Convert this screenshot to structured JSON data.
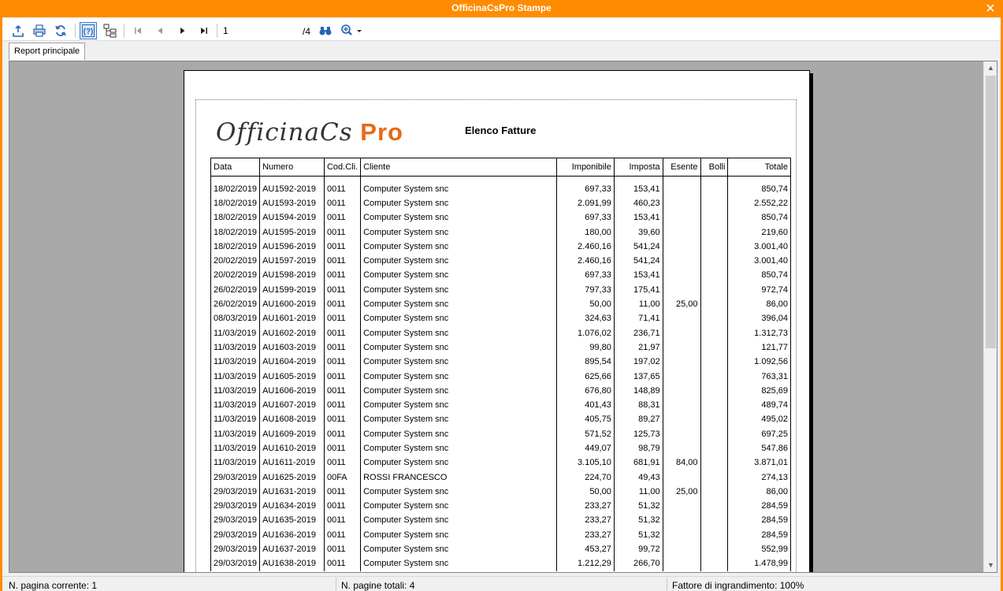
{
  "window": {
    "title": "OfficinaCsPro Stampe"
  },
  "toolbar": {
    "page_current": "1",
    "page_total": "/4",
    "icons": [
      "export-icon",
      "print-icon",
      "refresh-icon",
      "help-icon",
      "tree-icon",
      "first-page-icon",
      "prev-page-icon",
      "next-page-icon",
      "last-page-icon",
      "find-icon",
      "zoom-icon"
    ]
  },
  "tabs": [
    {
      "label": "Report principale"
    }
  ],
  "report": {
    "logo_a": "OfficinaCs",
    "logo_b": "Pro",
    "title": "Elenco Fatture",
    "columns": [
      "Data",
      "Numero",
      "Cod.Cli.",
      "Cliente",
      "Imponibile",
      "Imposta",
      "Esente",
      "Bolli",
      "Totale"
    ],
    "rows": [
      [
        "18/02/2019",
        "AU1592-2019",
        "0011",
        "Computer System snc",
        "697,33",
        "153,41",
        "",
        "",
        "850,74"
      ],
      [
        "18/02/2019",
        "AU1593-2019",
        "0011",
        "Computer System snc",
        "2.091,99",
        "460,23",
        "",
        "",
        "2.552,22"
      ],
      [
        "18/02/2019",
        "AU1594-2019",
        "0011",
        "Computer System snc",
        "697,33",
        "153,41",
        "",
        "",
        "850,74"
      ],
      [
        "18/02/2019",
        "AU1595-2019",
        "0011",
        "Computer System snc",
        "180,00",
        "39,60",
        "",
        "",
        "219,60"
      ],
      [
        "18/02/2019",
        "AU1596-2019",
        "0011",
        "Computer System snc",
        "2.460,16",
        "541,24",
        "",
        "",
        "3.001,40"
      ],
      [
        "20/02/2019",
        "AU1597-2019",
        "0011",
        "Computer System snc",
        "2.460,16",
        "541,24",
        "",
        "",
        "3.001,40"
      ],
      [
        "20/02/2019",
        "AU1598-2019",
        "0011",
        "Computer System snc",
        "697,33",
        "153,41",
        "",
        "",
        "850,74"
      ],
      [
        "26/02/2019",
        "AU1599-2019",
        "0011",
        "Computer System snc",
        "797,33",
        "175,41",
        "",
        "",
        "972,74"
      ],
      [
        "26/02/2019",
        "AU1600-2019",
        "0011",
        "Computer System snc",
        "50,00",
        "11,00",
        "25,00",
        "",
        "86,00"
      ],
      [
        "08/03/2019",
        "AU1601-2019",
        "0011",
        "Computer System snc",
        "324,63",
        "71,41",
        "",
        "",
        "396,04"
      ],
      [
        "11/03/2019",
        "AU1602-2019",
        "0011",
        "Computer System snc",
        "1.076,02",
        "236,71",
        "",
        "",
        "1.312,73"
      ],
      [
        "11/03/2019",
        "AU1603-2019",
        "0011",
        "Computer System snc",
        "99,80",
        "21,97",
        "",
        "",
        "121,77"
      ],
      [
        "11/03/2019",
        "AU1604-2019",
        "0011",
        "Computer System snc",
        "895,54",
        "197,02",
        "",
        "",
        "1.092,56"
      ],
      [
        "11/03/2019",
        "AU1605-2019",
        "0011",
        "Computer System snc",
        "625,66",
        "137,65",
        "",
        "",
        "763,31"
      ],
      [
        "11/03/2019",
        "AU1606-2019",
        "0011",
        "Computer System snc",
        "676,80",
        "148,89",
        "",
        "",
        "825,69"
      ],
      [
        "11/03/2019",
        "AU1607-2019",
        "0011",
        "Computer System snc",
        "401,43",
        "88,31",
        "",
        "",
        "489,74"
      ],
      [
        "11/03/2019",
        "AU1608-2019",
        "0011",
        "Computer System snc",
        "405,75",
        "89,27",
        "",
        "",
        "495,02"
      ],
      [
        "11/03/2019",
        "AU1609-2019",
        "0011",
        "Computer System snc",
        "571,52",
        "125,73",
        "",
        "",
        "697,25"
      ],
      [
        "11/03/2019",
        "AU1610-2019",
        "0011",
        "Computer System snc",
        "449,07",
        "98,79",
        "",
        "",
        "547,86"
      ],
      [
        "11/03/2019",
        "AU1611-2019",
        "0011",
        "Computer System snc",
        "3.105,10",
        "681,91",
        "84,00",
        "",
        "3.871,01"
      ],
      [
        "29/03/2019",
        "AU1625-2019",
        "00FA",
        "ROSSI FRANCESCO",
        "224,70",
        "49,43",
        "",
        "",
        "274,13"
      ],
      [
        "29/03/2019",
        "AU1631-2019",
        "0011",
        "Computer System snc",
        "50,00",
        "11,00",
        "25,00",
        "",
        "86,00"
      ],
      [
        "29/03/2019",
        "AU1634-2019",
        "0011",
        "Computer System snc",
        "233,27",
        "51,32",
        "",
        "",
        "284,59"
      ],
      [
        "29/03/2019",
        "AU1635-2019",
        "0011",
        "Computer System snc",
        "233,27",
        "51,32",
        "",
        "",
        "284,59"
      ],
      [
        "29/03/2019",
        "AU1636-2019",
        "0011",
        "Computer System snc",
        "233,27",
        "51,32",
        "",
        "",
        "284,59"
      ],
      [
        "29/03/2019",
        "AU1637-2019",
        "0011",
        "Computer System snc",
        "453,27",
        "99,72",
        "",
        "",
        "552,99"
      ],
      [
        "29/03/2019",
        "AU1638-2019",
        "0011",
        "Computer System snc",
        "1.212,29",
        "266,70",
        "",
        "",
        "1.478,99"
      ]
    ]
  },
  "status": {
    "current_page": "N. pagina corrente: 1",
    "total_pages": "N. pagine totali: 4",
    "zoom": "Fattore di ingrandimento: 100%"
  }
}
